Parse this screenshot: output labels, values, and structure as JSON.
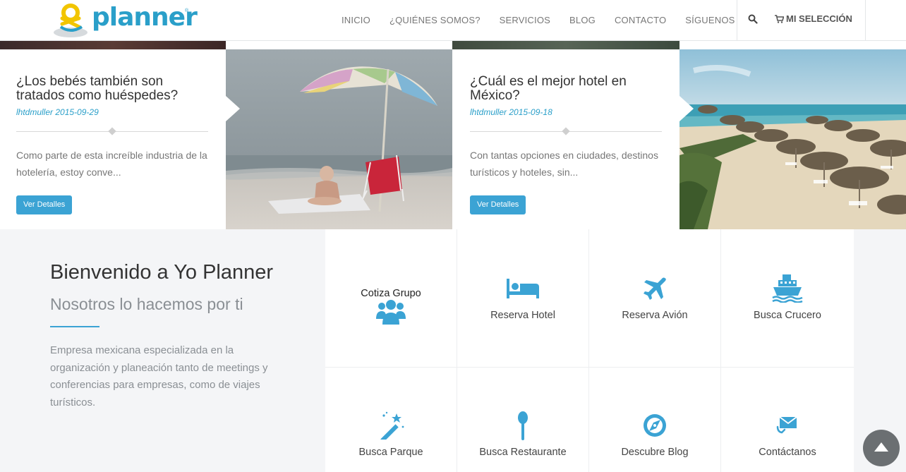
{
  "header": {
    "logo_text": "planner",
    "logo_tm": "®",
    "nav": [
      "INICIO",
      "¿QUIÉNES SOMOS?",
      "SERVICIOS",
      "BLOG",
      "CONTACTO",
      "SÍGUENOS"
    ],
    "search_icon": "search-icon",
    "selection_label": "MI SELECCIÓN",
    "selection_icon": "cart-icon"
  },
  "posts": [
    {
      "title": "¿Los bebés también son tratados como huéspedes?",
      "meta": "lhtdmuller 2015-09-29",
      "excerpt": "Como parte de esta increíble industria de la hotelería, estoy conve...",
      "button": "Ver Detalles"
    },
    {
      "title": "¿Cuál es el mejor hotel en México?",
      "meta": "lhtdmuller 2015-09-18",
      "excerpt": "Con tantas opciones en ciudades, destinos turísticos y hoteles, sin...",
      "button": "Ver Detalles"
    }
  ],
  "welcome": {
    "title": "Bienvenido a Yo Planner",
    "subtitle": "Nosotros lo hacemos por ti",
    "text": "Empresa mexicana especializada en la organización y planeación tanto de meetings y conferencias para empresas, como de viajes turísticos."
  },
  "services": [
    {
      "label": "Cotiza Grupo",
      "icon": "group-icon"
    },
    {
      "label": "Reserva Hotel",
      "icon": "bed-icon"
    },
    {
      "label": "Reserva Avión",
      "icon": "plane-icon"
    },
    {
      "label": "Busca Crucero",
      "icon": "ship-icon"
    },
    {
      "label": "Busca Parque",
      "icon": "magic-wand-icon"
    },
    {
      "label": "Busca Restaurante",
      "icon": "spoon-icon"
    },
    {
      "label": "Descubre Blog",
      "icon": "compass-icon"
    },
    {
      "label": "Contáctanos",
      "icon": "envelope-icon"
    }
  ],
  "colors": {
    "accent": "#3ba3d4",
    "logo": "#2a9fc9",
    "logo_yellow": "#f2c500",
    "section_bg": "#f4f5f7",
    "scroll_top_bg": "#6b6f72"
  },
  "back_to_top_icon": "arrow-up-icon"
}
